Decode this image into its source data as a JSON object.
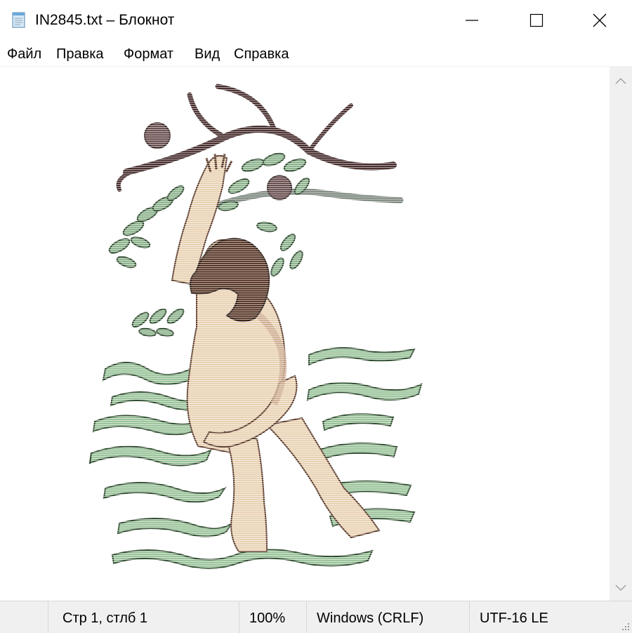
{
  "window": {
    "title": "IN2845.txt – Блокнот",
    "icon": "notepad-icon",
    "controls": {
      "minimize": "minimize-icon",
      "maximize": "maximize-icon",
      "close": "close-icon"
    }
  },
  "menu": {
    "items": [
      "Файл",
      "Правка",
      "Формат",
      "Вид",
      "Справка"
    ]
  },
  "editor": {
    "content": "ASCII-art image of a man standing in water reaching up toward a branch with fruit"
  },
  "statusbar": {
    "position": "Стр 1, стлб 1",
    "zoom": "100%",
    "line_ending": "Windows (CRLF)",
    "encoding": "UTF-16 LE"
  },
  "colors": {
    "skin": "#e9d2b4",
    "skin_shadow": "#c9a88c",
    "hair": "#5a3a2a",
    "branch": "#4a3030",
    "leaf": "#8fb48f",
    "leaf_dark": "#2f4a2f",
    "water": "#9bc49b",
    "fruit": "#6b5050"
  }
}
